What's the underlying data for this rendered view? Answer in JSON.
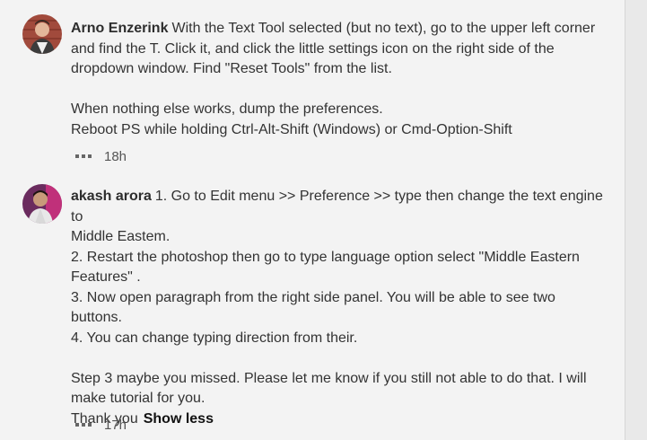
{
  "comments": [
    {
      "author": "Arno Enzerink",
      "first_line": "With the Text Tool selected (but no text), go to the upper left corner",
      "lines": [
        "and find the T. Click it, and click the little settings icon on the right side of the",
        "dropdown window. Find \"Reset Tools\" from the list."
      ],
      "lines2": [
        "When nothing else works, dump the preferences.",
        "Reboot PS while holding Ctrl-Alt-Shift (Windows) or Cmd-Option-Shift"
      ],
      "time": "18h",
      "avatar_icon": "user-avatar-icon"
    },
    {
      "author": "akash arora",
      "first_line": "1. Go to Edit menu >> Preference >> type then change the text engine to",
      "lines": [
        "Middle Eastem.",
        "2. Restart the photoshop then go to type language option select \"Middle Eastern",
        "Features\" .",
        "3. Now open paragraph from the right side panel. You will be able to see two",
        "buttons.",
        "4. You can change typing direction from their."
      ],
      "lines2": [
        "Step 3 maybe you missed. Please let me know if you still not able to do that. I will",
        "make tutorial for you."
      ],
      "last_line": "Thank you",
      "show_less": "Show less",
      "time": "17h",
      "avatar_icon": "user-avatar-icon"
    }
  ],
  "colors": {
    "background": "#f3f3f3",
    "text": "#333333",
    "author": "#2d2d2d"
  }
}
